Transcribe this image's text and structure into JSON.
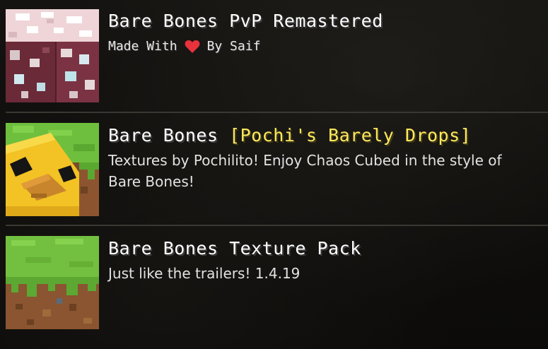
{
  "packs": [
    {
      "title": "Bare Bones PvP Remastered",
      "subtitle_prefix": "Made With",
      "subtitle_suffix": "By Saif",
      "icon": "ore-block-icon"
    },
    {
      "title_prefix": "Bare Bones ",
      "title_accent": "[Pochi's Barely Drops]",
      "description": "Textures by Pochilito! Enjoy Chaos Cubed in the style of Bare Bones!",
      "icon": "yellow-duck-grass-block-icon"
    },
    {
      "title": "Bare Bones Texture Pack",
      "description": "Just like the trailers! 1.4.19",
      "icon": "grass-block-icon"
    }
  ],
  "colors": {
    "background": "#0d0c0b",
    "title": "#ffffff",
    "accent": "#ffe85c",
    "heart": "#e8323c",
    "divider": "#3a3833"
  }
}
